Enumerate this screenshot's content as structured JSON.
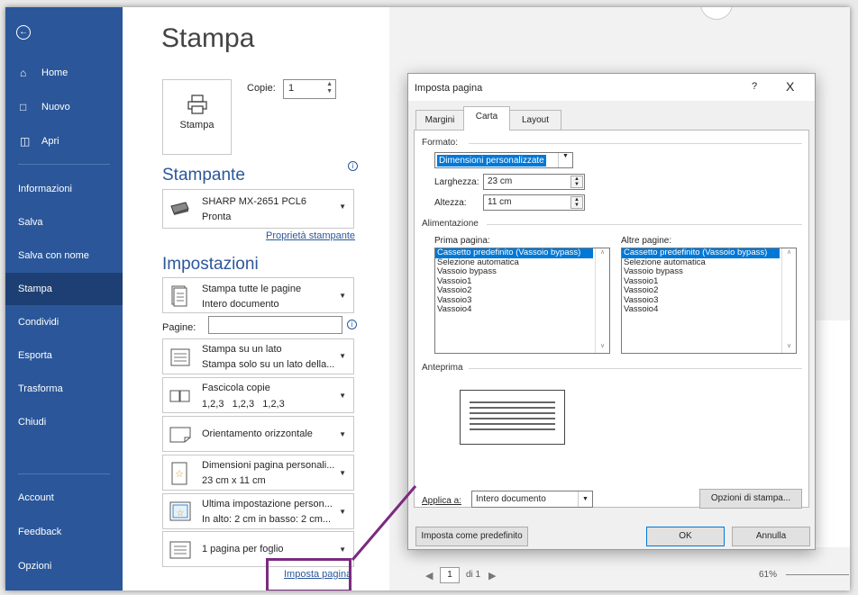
{
  "sidebar": {
    "items": [
      {
        "label": "Home",
        "icon": "home-icon"
      },
      {
        "label": "Nuovo",
        "icon": "new-doc-icon"
      },
      {
        "label": "Apri",
        "icon": "folder-open-icon"
      },
      {
        "label": "Informazioni"
      },
      {
        "label": "Salva"
      },
      {
        "label": "Salva con nome"
      },
      {
        "label": "Stampa",
        "active": true
      },
      {
        "label": "Condividi"
      },
      {
        "label": "Esporta"
      },
      {
        "label": "Trasforma"
      },
      {
        "label": "Chiudi"
      },
      {
        "label": "Account"
      },
      {
        "label": "Feedback"
      },
      {
        "label": "Opzioni"
      }
    ]
  },
  "print": {
    "title": "Stampa",
    "button_label": "Stampa",
    "copies_label": "Copie:",
    "copies_value": "1",
    "printer_section": "Stampante",
    "printer_name": "SHARP MX-2651 PCL6",
    "printer_status": "Pronta",
    "printer_props_link": "Proprietà stampante",
    "settings_section": "Impostazioni",
    "pages_label": "Pagine:",
    "page_setup_link": "Imposta pagina",
    "settings": [
      {
        "l1": "Stampa tutte le pagine",
        "l2": "Intero documento"
      },
      {
        "l1": "Stampa su un lato",
        "l2": "Stampa solo su un lato della..."
      },
      {
        "l1": "Fascicola copie",
        "l2": "1,2,3   1,2,3   1,2,3"
      },
      {
        "l1": "Orientamento orizzontale",
        "l2": ""
      },
      {
        "l1": "Dimensioni pagina personali...",
        "l2": "23 cm x 11 cm"
      },
      {
        "l1": "Ultima impostazione person...",
        "l2": "In alto: 2 cm in basso: 2 cm..."
      },
      {
        "l1": "1 pagina per foglio",
        "l2": ""
      }
    ]
  },
  "preview": {
    "page_current": "1",
    "page_total": "di 1",
    "zoom": "61%"
  },
  "dialog": {
    "title": "Imposta pagina",
    "help": "?",
    "close": "X",
    "tabs": [
      "Margini",
      "Carta",
      "Layout"
    ],
    "active_tab": "Carta",
    "format_group": "Formato:",
    "format_value": "Dimensioni personalizzate",
    "width_label": "Larghezza:",
    "width_value": "23 cm",
    "height_label": "Altezza:",
    "height_value": "11 cm",
    "feed_group": "Alimentazione",
    "first_page_label": "Prima pagina:",
    "other_pages_label": "Altre pagine:",
    "trays": [
      "Cassetto predefinito (Vassoio bypass)",
      "Selezione automatica",
      "Vassoio bypass",
      "Vassoio1",
      "Vassoio2",
      "Vassoio3",
      "Vassoio4"
    ],
    "preview_group": "Anteprima",
    "apply_label": "Applica a:",
    "apply_value": "Intero documento",
    "print_options_button": "Opzioni di stampa...",
    "set_default_button": "Imposta come predefinito",
    "ok_button": "OK",
    "cancel_button": "Annulla"
  },
  "colors": {
    "sidebar": "#2b579a",
    "sidebar_active": "#1e3f73",
    "selection": "#0078d7",
    "annotation": "#7b2a80"
  }
}
